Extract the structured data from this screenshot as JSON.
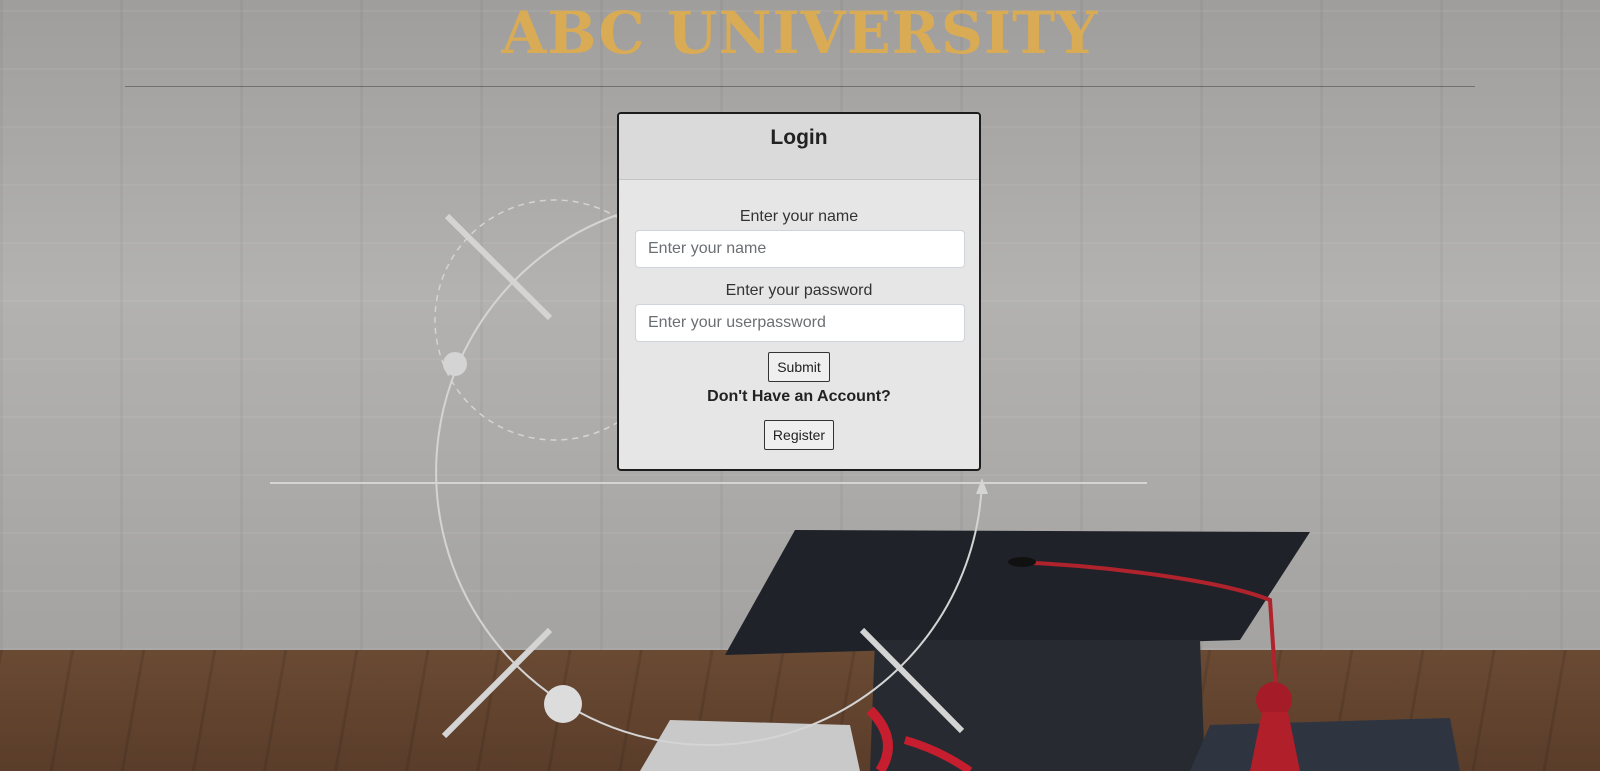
{
  "header": {
    "title": "ABC UNIVERSITY"
  },
  "login": {
    "title": "Login",
    "name_label": "Enter your name",
    "name_placeholder": "Enter your name",
    "name_value": "",
    "password_label": "Enter your password",
    "password_placeholder": "Enter your userpassword",
    "password_value": "",
    "submit_label": "Submit",
    "no_account_prompt": "Don't Have an Account?",
    "register_label": "Register"
  },
  "colors": {
    "title": "#d9ab55",
    "card_background": "#e6e6e6",
    "card_header": "#dadada",
    "card_border": "#1c1c1c"
  }
}
